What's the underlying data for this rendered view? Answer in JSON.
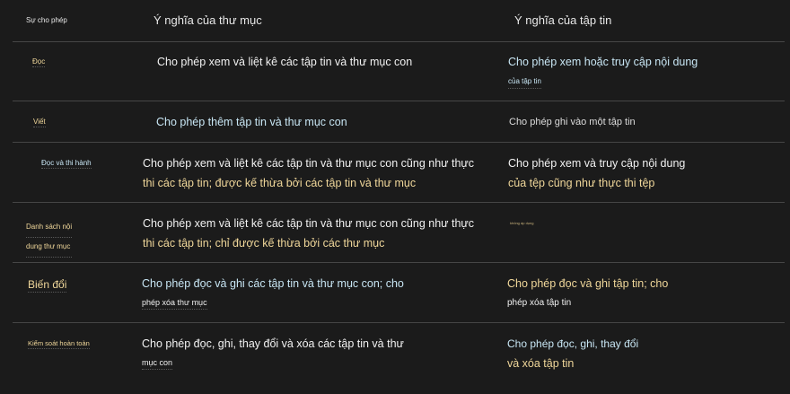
{
  "headers": {
    "permission": "Sự cho phép",
    "folder": "Ý nghĩa của thư mục",
    "file": "Ý nghĩa của tập tin"
  },
  "rows": [
    {
      "permission": [
        "Đọc"
      ],
      "folder": [
        "Cho phép xem và liệt kê các tập tin và thư mục con"
      ],
      "file": [
        "Cho phép xem hoặc truy cập nội dung",
        "của tập tin"
      ]
    },
    {
      "permission": [
        "Viết"
      ],
      "folder": [
        "Cho phép thêm tập tin và thư mục con"
      ],
      "file": [
        "Cho phép ghi vào một tập tin"
      ]
    },
    {
      "permission": [
        "Đọc và thi hành"
      ],
      "folder": [
        "Cho phép xem và liệt kê các tập tin và thư mục con cũng như thực",
        "thi các tập tin; được kế thừa bởi các tập tin và thư mục"
      ],
      "file": [
        "Cho phép xem và truy cập nội dung",
        "của tệp cũng như thực thi tệp"
      ]
    },
    {
      "permission": [
        "Danh sách nội",
        "dung thư mục"
      ],
      "folder": [
        "Cho phép xem và liệt kê các tập tin và thư mục con cũng như thực",
        "thi các tập tin; chỉ được kế thừa bởi các thư mục"
      ],
      "file": [
        "không áp dụng"
      ]
    },
    {
      "permission": [
        "Biến đổi"
      ],
      "folder": [
        "Cho phép đọc và ghi các tập tin và thư mục con; cho",
        "phép xóa thư mục"
      ],
      "file": [
        "Cho phép đọc và ghi tập tin; cho",
        "phép xóa tập tin"
      ]
    },
    {
      "permission": [
        "Kiểm soát hoàn toàn"
      ],
      "folder": [
        "Cho phép đọc, ghi, thay đổi và xóa các tập tin và thư",
        "mục con"
      ],
      "file": [
        "Cho phép đọc, ghi, thay đổi",
        "và xóa tập tin"
      ]
    }
  ],
  "colors": {
    "background": "#1b1b1b",
    "rule": "#464646",
    "yellow": "#f0d79a",
    "blue": "#c8e6f4",
    "white": "#f2f2f2"
  }
}
